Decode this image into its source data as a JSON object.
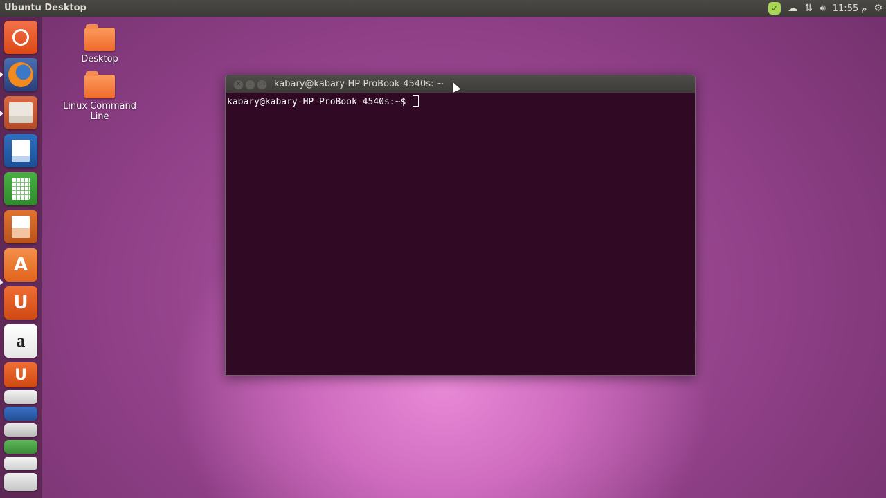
{
  "top_panel": {
    "title": "Ubuntu Desktop",
    "indicators": {
      "clock": "11:55 م"
    }
  },
  "launcher": {
    "items": [
      {
        "name": "ubuntu-dash",
        "color": "#e95420"
      },
      {
        "name": "firefox",
        "color": "#f48024"
      },
      {
        "name": "files",
        "color": "#e8e3da"
      },
      {
        "name": "libreoffice-writer",
        "color": "#2a6bb5"
      },
      {
        "name": "libreoffice-calc",
        "color": "#3fa33b"
      },
      {
        "name": "libreoffice-impress",
        "color": "#d35d1b"
      },
      {
        "name": "ubuntu-software-center",
        "color": "#ef7c2b"
      },
      {
        "name": "ubuntu-one",
        "color": "#e05a1c"
      },
      {
        "name": "amazon",
        "color": "#ffffff"
      },
      {
        "name": "ubuntu-one-stacked",
        "color": "#e05a1c"
      }
    ],
    "icon_text": {
      "appcenter": "A",
      "ubuntuone": "U",
      "amazon": "a",
      "ubuntuone2": "U"
    }
  },
  "desktop": {
    "icons": [
      {
        "label": "Desktop"
      },
      {
        "label": "Linux Command Line"
      }
    ]
  },
  "terminal": {
    "title": "kabary@kabary-HP-ProBook-4540s: ~",
    "prompt": "kabary@kabary-HP-ProBook-4540s:~$",
    "background": "#300a24"
  }
}
